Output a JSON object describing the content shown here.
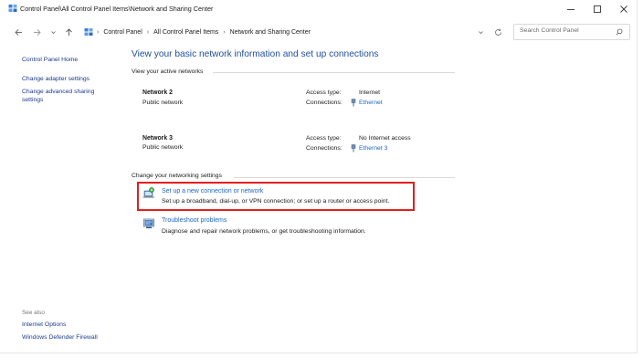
{
  "window": {
    "title": "Control Panel\\All Control Panel Items\\Network and Sharing Center"
  },
  "nav": {
    "breadcrumbs": [
      "Control Panel",
      "All Control Panel Items",
      "Network and Sharing Center"
    ],
    "search_placeholder": "Search Control Panel"
  },
  "sidebar": {
    "home": "Control Panel Home",
    "items": [
      "Change adapter settings",
      "Change advanced sharing",
      "settings"
    ],
    "see_also_label": "See also",
    "see_also": [
      "Internet Options",
      "Windows Defender Firewall"
    ]
  },
  "main": {
    "heading": "View your basic network information and set up connections",
    "active_label": "View your active networks",
    "networks": [
      {
        "name": "Network 2",
        "category": "Public network",
        "access_label": "Access type:",
        "access": "Internet",
        "conn_label": "Connections:",
        "connection": "Ethernet"
      },
      {
        "name": "Network 3",
        "category": "Public network",
        "access_label": "Access type:",
        "access": "No Internet access",
        "conn_label": "Connections:",
        "connection": "Ethernet 3"
      }
    ],
    "change_label": "Change your networking settings",
    "tasks": [
      {
        "title": "Set up a new connection or network",
        "desc": "Set up a broadband, dial-up, or VPN connection; or set up a router or access point."
      },
      {
        "title": "Troubleshoot problems",
        "desc": "Diagnose and repair network problems, or get troubleshooting information."
      }
    ]
  },
  "colors": {
    "heading": "#1f4e9a",
    "link": "#1e66c8",
    "highlight": "#e02020"
  }
}
